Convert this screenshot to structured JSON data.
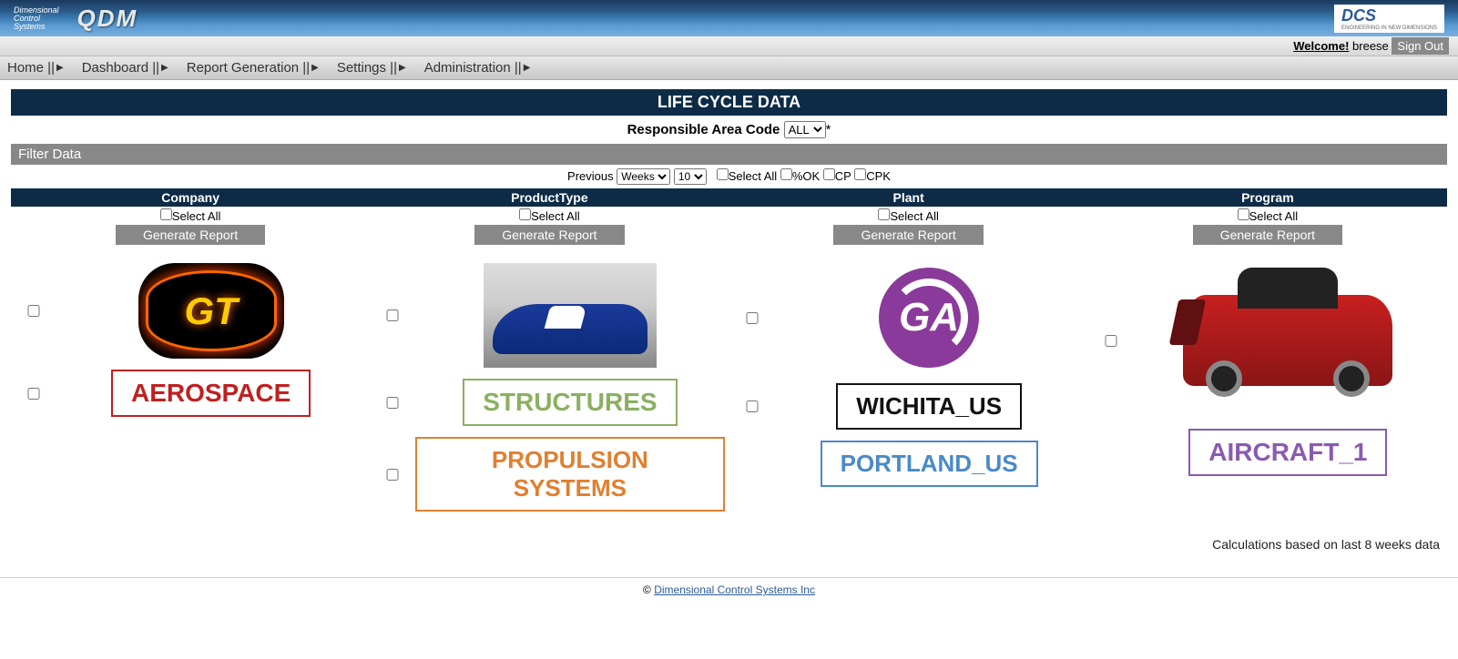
{
  "banner": {
    "dcs_text1": "Dimensional",
    "dcs_text2": "Control",
    "dcs_text3": "Systems",
    "qdm": "QDM",
    "dcs_logo": "DCS",
    "dcs_tag": "ENGINEERING IN NEW DIMENSIONS"
  },
  "welcome": {
    "label": "Welcome!",
    "user": "breese",
    "signout": "Sign Out"
  },
  "menu": {
    "home": "Home ||",
    "dashboard": "Dashboard ||",
    "report": "Report Generation ||",
    "settings": "Settings ||",
    "admin": "Administration ||"
  },
  "page_title": "LIFE CYCLE DATA",
  "rac": {
    "label": "Responsible Area Code",
    "value": "ALL",
    "asterisk": "*"
  },
  "filter_label": "Filter Data",
  "prev": {
    "label": "Previous",
    "unit": "Weeks",
    "count": "10",
    "select_all": "Select All",
    "pok": "%OK",
    "cp": "CP",
    "cpk": "CPK"
  },
  "cols": {
    "company": {
      "header": "Company",
      "sa": "Select All",
      "gen": "Generate Report"
    },
    "product": {
      "header": "ProductType",
      "sa": "Select All",
      "gen": "Generate Report"
    },
    "plant": {
      "header": "Plant",
      "sa": "Select All",
      "gen": "Generate Report"
    },
    "program": {
      "header": "Program",
      "sa": "Select All",
      "gen": "Generate Report"
    }
  },
  "items": {
    "gt": "GT",
    "ga": "GA",
    "aerospace": "AEROSPACE",
    "structures": "STRUCTURES",
    "propulsion": "PROPULSION SYSTEMS",
    "wichita": "WICHITA_US",
    "portland": "PORTLAND_US",
    "aircraft1": "AIRCRAFT_1"
  },
  "calc_note": "Calculations based on last 8 weeks data",
  "footer": {
    "copy": "©",
    "link": "Dimensional Control Systems Inc"
  }
}
